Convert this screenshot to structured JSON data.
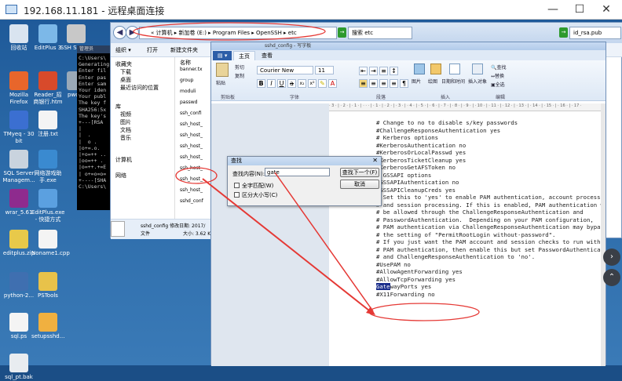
{
  "window": {
    "title": "192.168.11.181 - 远程桌面连接",
    "minimize": "—",
    "maximize": "☐",
    "close": "✕"
  },
  "desktop_icons": [
    {
      "label": "回收站",
      "color": "#d9e4f0"
    },
    {
      "label": "EditPlus 3",
      "color": "#7cb8e8"
    },
    {
      "label": "SSH Secure",
      "color": "#c8c8c8"
    },
    {
      "label": "Mozilla Firefox",
      "color": "#e8662b"
    },
    {
      "label": "Reader_招商银行.htm",
      "color": "#d84a2b"
    },
    {
      "label": "pwdbr",
      "color": "#9aa9b8"
    },
    {
      "label": "TMyeq - 30 bit",
      "color": "#3b6fd1"
    },
    {
      "label": "注册.txt",
      "color": "#f4f4f4"
    },
    {
      "label": "SQL Server Managem...",
      "color": "#c9d3de"
    },
    {
      "label": "网络游戏助手.exe",
      "color": "#3a8ad0"
    },
    {
      "label": "wrar_5.61",
      "color": "#8e2b8e"
    },
    {
      "label": "EditPlus.exe - 快捷方式",
      "color": "#5ba0e0"
    },
    {
      "label": "editplus.zip",
      "color": "#e8c94a"
    },
    {
      "label": "Noname1.cpp",
      "color": "#f4f4f4"
    },
    {
      "label": "python-2...",
      "color": "#3f6fb0"
    },
    {
      "label": "PSTools",
      "color": "#e8c24a"
    },
    {
      "label": "sql.ps",
      "color": "#f4f4f4"
    },
    {
      "label": "setupsshd...",
      "color": "#f0b040"
    },
    {
      "label": "sql_pt.bak",
      "color": "#e8ecf0"
    }
  ],
  "cmd": {
    "title": "管理员",
    "lines": [
      "C:\\Users\\",
      "Generating",
      "Enter fil",
      "Enter pas",
      "Enter sam",
      "Your iden",
      "Your publ",
      "The key f",
      "SHA256:5x",
      "The key's",
      "+---[RSA",
      "|        ",
      "|  .     ",
      "|  o .   ",
      "|o+=.o.  ",
      "|+o=++ ..",
      "|oo=++ . ",
      "|o=++.+=E",
      "| o+=o=o=",
      "+----[SHA",
      "",
      "C:\\Users\\"
    ]
  },
  "explorer": {
    "address": "« 计算机 ▸ 新加卷 (E:) ▸ Program Files ▸ OpenSSH ▸ etc",
    "search_placeholder": "搜索 etc",
    "search2": "id_rsa.pub",
    "toolbar": [
      "组织 ▾",
      "打开",
      "新建文件夹"
    ],
    "column_name": "名称",
    "nav": [
      "收藏夹",
      "下载",
      "桌面",
      "最近访问的位置",
      "库",
      "视频",
      "图片",
      "文档",
      "音乐",
      "计算机",
      "网络"
    ],
    "files": [
      "banner.tx",
      "group",
      "moduli",
      "passwd",
      "ssh_confi",
      "ssh_host_",
      "ssh_host_",
      "ssh_host_",
      "ssh_host_",
      "ssh_host_",
      "ssh_host_",
      "ssh_host_",
      "sshd_conf"
    ],
    "details_name": "sshd_config 修改日期: 2017/",
    "details_type": "文件",
    "details_size": "大小: 3.62 K"
  },
  "wordpad": {
    "title": "sshd_config - 写字板",
    "tabs": [
      "主页",
      "查看"
    ],
    "clipboard": [
      "粘贴",
      "剪切",
      "复制"
    ],
    "font_name": "Courier New",
    "font_size": "11",
    "insert": [
      "图片",
      "绘图",
      "日期和时间",
      "插入对象"
    ],
    "edit": [
      "查找",
      "替换",
      "全选"
    ],
    "group_labels": [
      "剪贴板",
      "字体",
      "段落",
      "插入",
      "编辑"
    ],
    "ruler": "· 3 · | · 2 · | · 1 · | · · · | · 1 · | · 2 · | · 3 · | · 4 · | · 5 · | · 6 · | · 7 · | · 8 · | · 9 · | · 10 · | · 11 · | · 12 · | · 13 · | · 14 · | · 15 · | · 16 · | · 17 ·",
    "lines": [
      "# Change to no to disable s/key passwords",
      "#ChallengeResponseAuthentication yes",
      "",
      "# Kerberos options",
      "#KerberosAuthentication no",
      "#KerberosOrLocalPasswd yes",
      "#KerberosTicketCleanup yes",
      "#KerberosGetAFSToken no",
      "",
      "# GSSAPI options",
      "#GSSAPIAuthentication no",
      "#GSSAPICleanupCreds yes",
      "",
      "# Set this to 'yes' to enable PAM authentication, account processing,",
      "# and session processing. If this is enabled, PAM authentication will",
      "# be allowed through the ChallengeResponseAuthentication and",
      "# PasswordAuthentication.  Depending on your PAM configuration,",
      "# PAM authentication via ChallengeResponseAuthentication may bypass",
      "# the setting of \"PermitRootLogin without-password\".",
      "# If you just want the PAM account and session checks to run without",
      "# PAM authentication, then enable this but set PasswordAuthentication",
      "# and ChallengeResponseAuthentication to 'no'.",
      "#UsePAM no",
      "",
      "#AllowAgentForwarding yes",
      "#AllowTcpForwarding yes",
      "GatewayPorts yes",
      "#X11Forwarding no"
    ],
    "highlight_prefix": "Gate",
    "highlight_rest": "wayPorts yes"
  },
  "find": {
    "title": "查找",
    "label": "查找内容(N):",
    "value": "gate",
    "find_next": "查找下一个(F)",
    "cancel": "取消",
    "whole_word": "全字匹配(W)",
    "match_case": "区分大小写(C)"
  },
  "colors": {
    "annotation": "#e53935",
    "accent": "#1a2e8c"
  }
}
